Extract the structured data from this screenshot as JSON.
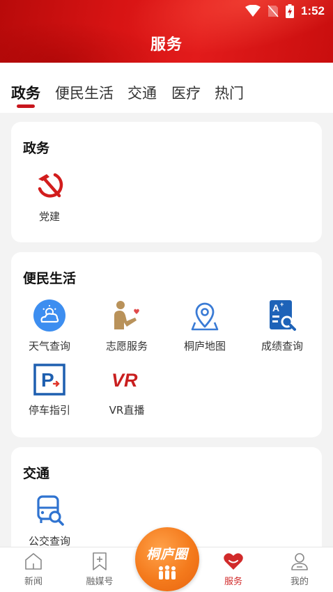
{
  "status_bar": {
    "time": "1:52",
    "icons": [
      "wifi-icon",
      "no-sim-icon",
      "battery-charging-icon"
    ]
  },
  "header": {
    "title": "服务"
  },
  "tabs": [
    {
      "label": "政务",
      "active": true
    },
    {
      "label": "便民生活",
      "active": false
    },
    {
      "label": "交通",
      "active": false
    },
    {
      "label": "医疗",
      "active": false
    },
    {
      "label": "热门",
      "active": false
    }
  ],
  "sections": {
    "politics": {
      "title": "政务",
      "items": [
        {
          "label": "党建",
          "icon": "party-emblem-icon"
        }
      ]
    },
    "life": {
      "title": "便民生活",
      "items": [
        {
          "label": "天气查询",
          "icon": "weather-icon"
        },
        {
          "label": "志愿服务",
          "icon": "volunteer-icon"
        },
        {
          "label": "桐庐地图",
          "icon": "map-pin-icon"
        },
        {
          "label": "成绩查询",
          "icon": "grade-search-icon"
        },
        {
          "label": "停车指引",
          "icon": "parking-icon"
        },
        {
          "label": "VR直播",
          "icon": "vr-icon"
        }
      ]
    },
    "traffic": {
      "title": "交通",
      "items": [
        {
          "label": "公交查询",
          "icon": "bus-search-icon"
        }
      ]
    }
  },
  "bottom_nav": {
    "items": [
      {
        "label": "新闻",
        "icon": "home-icon",
        "active": false
      },
      {
        "label": "融媒号",
        "icon": "bookmark-plus-icon",
        "active": false
      },
      {
        "label": "服务",
        "icon": "heart-service-icon",
        "active": true
      },
      {
        "label": "我的",
        "icon": "user-icon",
        "active": false
      }
    ],
    "center": {
      "label": "桐庐圈",
      "icon": "people-group-icon"
    }
  },
  "colors": {
    "brand_red": "#d81414",
    "active_red": "#d12a2a",
    "orange": "#f47a1c",
    "blue": "#3a7bd5"
  }
}
